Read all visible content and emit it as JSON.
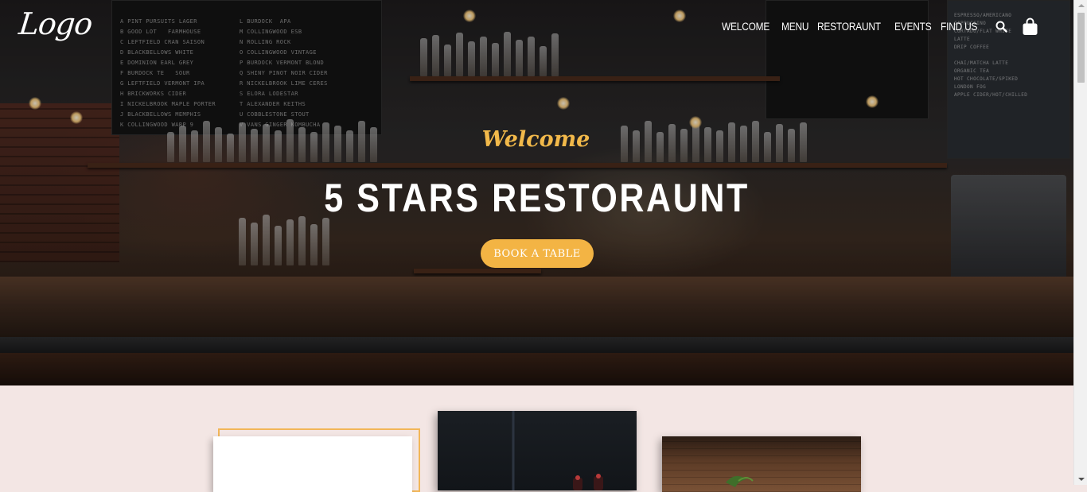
{
  "header": {
    "logo_text": "Logo",
    "nav": [
      {
        "label": "WELCOME"
      },
      {
        "label": "MENU"
      },
      {
        "label": "RESTORAUNT"
      },
      {
        "label": "EVENTS"
      },
      {
        "label": "FIND US"
      }
    ],
    "icons": [
      "search-icon",
      "shopping-bag-icon"
    ]
  },
  "hero": {
    "welcome": "Welcome",
    "title": "5 STARS RESTORAUNT",
    "cta_label": "BOOK A TABLE"
  },
  "theme": {
    "accent": "#f3b444",
    "page_background": "#f3e6e4"
  }
}
